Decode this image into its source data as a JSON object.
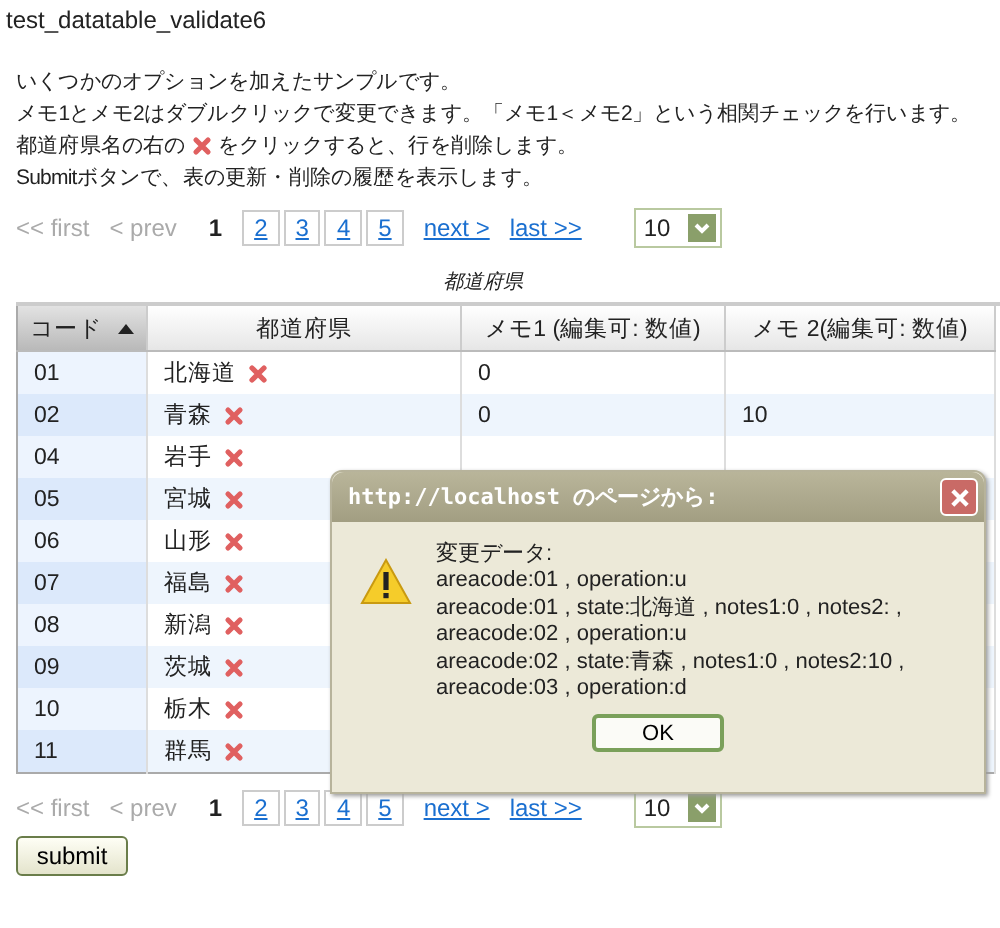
{
  "page_title": "test_datatable_validate6",
  "description": [
    {
      "kind": "plain",
      "text": "いくつかのオプションを加えたサンプルです。"
    },
    {
      "kind": "plain",
      "text": "メモ1とメモ2はダブルクリックで変更できます。「メモ1＜メモ2」という相関チェックを行います。"
    },
    {
      "kind": "with_delete_icon",
      "text": "都道府県名の右の",
      "text_after": "をクリックすると、行を削除します。"
    },
    {
      "kind": "plain",
      "text": "Submitボタンで、表の更新・削除の履歴を表示します。"
    }
  ],
  "top_pager": {
    "first": {
      "label": "<< first",
      "disabled": true
    },
    "prev": {
      "label": "< prev",
      "disabled": true
    },
    "pages": [
      {
        "label": "1",
        "selected": true
      },
      {
        "label": "2",
        "selected": false
      },
      {
        "label": "3",
        "selected": false
      },
      {
        "label": "4",
        "selected": false
      },
      {
        "label": "5",
        "selected": false
      }
    ],
    "next": {
      "label": "next >",
      "disabled": false
    },
    "last": {
      "label": "last >>",
      "disabled": false
    },
    "page_size": "10"
  },
  "table": {
    "caption": "都道府県",
    "columns": [
      {
        "label": "コード",
        "sorted": true
      },
      {
        "label": "都道府県",
        "sorted": false
      },
      {
        "label": "メモ1 (編集可: 数値)",
        "sorted": false
      },
      {
        "label": "メモ 2(編集可: 数値)",
        "sorted": false
      }
    ],
    "rows": [
      {
        "code": "01",
        "prefecture": "北海道",
        "memo1": "0",
        "memo2": ""
      },
      {
        "code": "02",
        "prefecture": "青森",
        "memo1": "0",
        "memo2": "10"
      },
      {
        "code": "04",
        "prefecture": "岩手",
        "memo1": "",
        "memo2": ""
      },
      {
        "code": "05",
        "prefecture": "宮城",
        "memo1": "",
        "memo2": ""
      },
      {
        "code": "06",
        "prefecture": "山形",
        "memo1": "",
        "memo2": ""
      },
      {
        "code": "07",
        "prefecture": "福島",
        "memo1": "",
        "memo2": ""
      },
      {
        "code": "08",
        "prefecture": "新潟",
        "memo1": "",
        "memo2": ""
      },
      {
        "code": "09",
        "prefecture": "茨城",
        "memo1": "",
        "memo2": ""
      },
      {
        "code": "10",
        "prefecture": "栃木",
        "memo1": "",
        "memo2": ""
      },
      {
        "code": "11",
        "prefecture": "群馬",
        "memo1": "",
        "memo2": ""
      }
    ]
  },
  "bottom_pager": {
    "first": {
      "label": "<< first",
      "disabled": true
    },
    "prev": {
      "label": "< prev",
      "disabled": true
    },
    "pages": [
      {
        "label": "1",
        "selected": true
      },
      {
        "label": "2",
        "selected": false
      },
      {
        "label": "3",
        "selected": false
      },
      {
        "label": "4",
        "selected": false
      },
      {
        "label": "5",
        "selected": false
      }
    ],
    "next": {
      "label": "next >",
      "disabled": false
    },
    "last": {
      "label": "last >>",
      "disabled": false
    },
    "page_size": "10"
  },
  "submit_button": "submit",
  "dialog": {
    "title": "http://localhost のページから:",
    "lines": [
      "変更データ:",
      "areacode:01 , operation:u",
      "areacode:01 , state:北海道 , notes1:0 , notes2: ,",
      "areacode:02 , operation:u",
      "areacode:02 , state:青森 , notes1:0 , notes2:10 ,",
      "areacode:03 , operation:d"
    ],
    "ok_button": "OK"
  }
}
